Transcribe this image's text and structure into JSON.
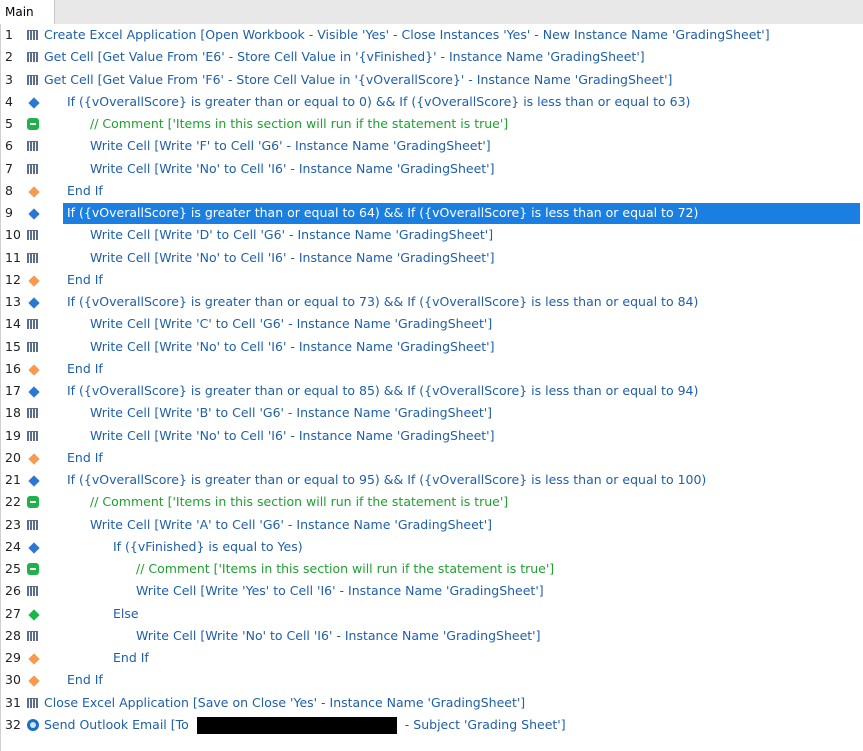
{
  "tab": {
    "label": "Main"
  },
  "lines": [
    {
      "n": "1",
      "icon": "grid",
      "indent": 0,
      "text": "Create Excel Application [Open Workbook - Visible 'Yes' - Close Instances 'Yes' - New Instance Name 'GradingSheet']"
    },
    {
      "n": "2",
      "icon": "grid",
      "indent": 0,
      "text": "Get Cell [Get Value From 'E6' - Store Cell Value in '{vFinished}' - Instance Name 'GradingSheet']"
    },
    {
      "n": "3",
      "icon": "grid",
      "indent": 0,
      "text": "Get Cell [Get Value From 'F6' - Store Cell Value in '{vOverallScore}' - Instance Name 'GradingSheet']"
    },
    {
      "n": "4",
      "icon": "dia-blue",
      "indent": 1,
      "text": "If ({vOverallScore} is greater than or equal to 0) && If ({vOverallScore} is less than or equal to 63)"
    },
    {
      "n": "5",
      "icon": "comment",
      "indent": 2,
      "text": "// Comment ['Items in this section will run if the statement is true']",
      "comment": true
    },
    {
      "n": "6",
      "icon": "grid",
      "indent": 2,
      "text": "Write Cell [Write 'F' to Cell 'G6' - Instance Name 'GradingSheet']"
    },
    {
      "n": "7",
      "icon": "grid",
      "indent": 2,
      "text": "Write Cell [Write 'No' to Cell 'I6' - Instance Name 'GradingSheet']"
    },
    {
      "n": "8",
      "icon": "dia-orange",
      "indent": 1,
      "text": "End If"
    },
    {
      "n": "9",
      "icon": "dia-blue",
      "indent": 1,
      "text": "If ({vOverallScore} is greater than or equal to 64) && If ({vOverallScore} is less than or equal to 72)",
      "selected": true
    },
    {
      "n": "10",
      "icon": "grid",
      "indent": 2,
      "text": "Write Cell [Write 'D' to Cell 'G6' - Instance Name 'GradingSheet']"
    },
    {
      "n": "11",
      "icon": "grid",
      "indent": 2,
      "text": "Write Cell [Write 'No' to Cell 'I6' - Instance Name 'GradingSheet']"
    },
    {
      "n": "12",
      "icon": "dia-orange",
      "indent": 1,
      "text": "End If"
    },
    {
      "n": "13",
      "icon": "dia-blue",
      "indent": 1,
      "text": "If ({vOverallScore} is greater than or equal to 73) && If ({vOverallScore} is less than or equal to 84)"
    },
    {
      "n": "14",
      "icon": "grid",
      "indent": 2,
      "text": "Write Cell [Write 'C' to Cell 'G6' - Instance Name 'GradingSheet']"
    },
    {
      "n": "15",
      "icon": "grid",
      "indent": 2,
      "text": "Write Cell [Write 'No' to Cell 'I6' - Instance Name 'GradingSheet']"
    },
    {
      "n": "16",
      "icon": "dia-orange",
      "indent": 1,
      "text": "End If"
    },
    {
      "n": "17",
      "icon": "dia-blue",
      "indent": 1,
      "text": "If ({vOverallScore} is greater than or equal to 85) && If ({vOverallScore} is less than or equal to 94)"
    },
    {
      "n": "18",
      "icon": "grid",
      "indent": 2,
      "text": "Write Cell [Write 'B' to Cell 'G6' - Instance Name 'GradingSheet']"
    },
    {
      "n": "19",
      "icon": "grid",
      "indent": 2,
      "text": "Write Cell [Write 'No' to Cell 'I6' - Instance Name 'GradingSheet']"
    },
    {
      "n": "20",
      "icon": "dia-orange",
      "indent": 1,
      "text": "End If"
    },
    {
      "n": "21",
      "icon": "dia-blue",
      "indent": 1,
      "text": "If ({vOverallScore} is greater than or equal to 95) && If ({vOverallScore} is less than or equal to 100)"
    },
    {
      "n": "22",
      "icon": "comment",
      "indent": 2,
      "text": "// Comment ['Items in this section will run if the statement is true']",
      "comment": true
    },
    {
      "n": "23",
      "icon": "grid",
      "indent": 2,
      "text": "Write Cell [Write 'A' to Cell 'G6' - Instance Name 'GradingSheet']"
    },
    {
      "n": "24",
      "icon": "dia-blue",
      "indent": 3,
      "text": "If ({vFinished} is equal to Yes)"
    },
    {
      "n": "25",
      "icon": "comment",
      "indent": 4,
      "text": "// Comment ['Items in this section will run if the statement is true']",
      "comment": true
    },
    {
      "n": "26",
      "icon": "grid",
      "indent": 4,
      "text": "Write Cell [Write 'Yes' to Cell 'I6' - Instance Name 'GradingSheet']"
    },
    {
      "n": "27",
      "icon": "dia-green",
      "indent": 3,
      "text": "Else"
    },
    {
      "n": "28",
      "icon": "grid",
      "indent": 4,
      "text": "Write Cell [Write 'No' to Cell 'I6' - Instance Name 'GradingSheet']"
    },
    {
      "n": "29",
      "icon": "dia-orange",
      "indent": 3,
      "text": "End If"
    },
    {
      "n": "30",
      "icon": "dia-orange",
      "indent": 1,
      "text": "End If"
    },
    {
      "n": "31",
      "icon": "grid",
      "indent": 0,
      "text": "Close Excel Application [Save on Close 'Yes' - Instance Name 'GradingSheet']"
    },
    {
      "n": "32",
      "icon": "outlook",
      "indent": 0,
      "text": "Send Outlook Email [To",
      "text_after": "- Subject 'Grading Sheet']",
      "redacted": true
    }
  ]
}
